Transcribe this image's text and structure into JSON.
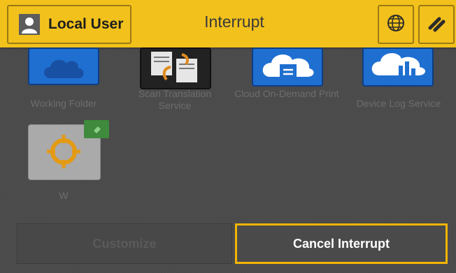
{
  "header": {
    "user_label": "Local User",
    "title": "Interrupt",
    "globe_icon": "globe-icon",
    "brush_icon": "brush-icon"
  },
  "apps": [
    {
      "label": "Working Folder",
      "icon": "cloud-icon"
    },
    {
      "label": "Scan Translation Service",
      "icon": "scan-translation-icon"
    },
    {
      "label": "Cloud On-Demand Print",
      "icon": "cloud-print-icon"
    },
    {
      "label": "Device Log Service",
      "icon": "device-log-icon"
    },
    {
      "label": "W",
      "icon": "crosshair-icon"
    }
  ],
  "buttons": {
    "customize": "Customize",
    "cancel_interrupt": "Cancel Interrupt"
  },
  "colors": {
    "header": "#f2c11c",
    "highlight": "#f4b400",
    "tile_blue": "#1f6fd0"
  }
}
